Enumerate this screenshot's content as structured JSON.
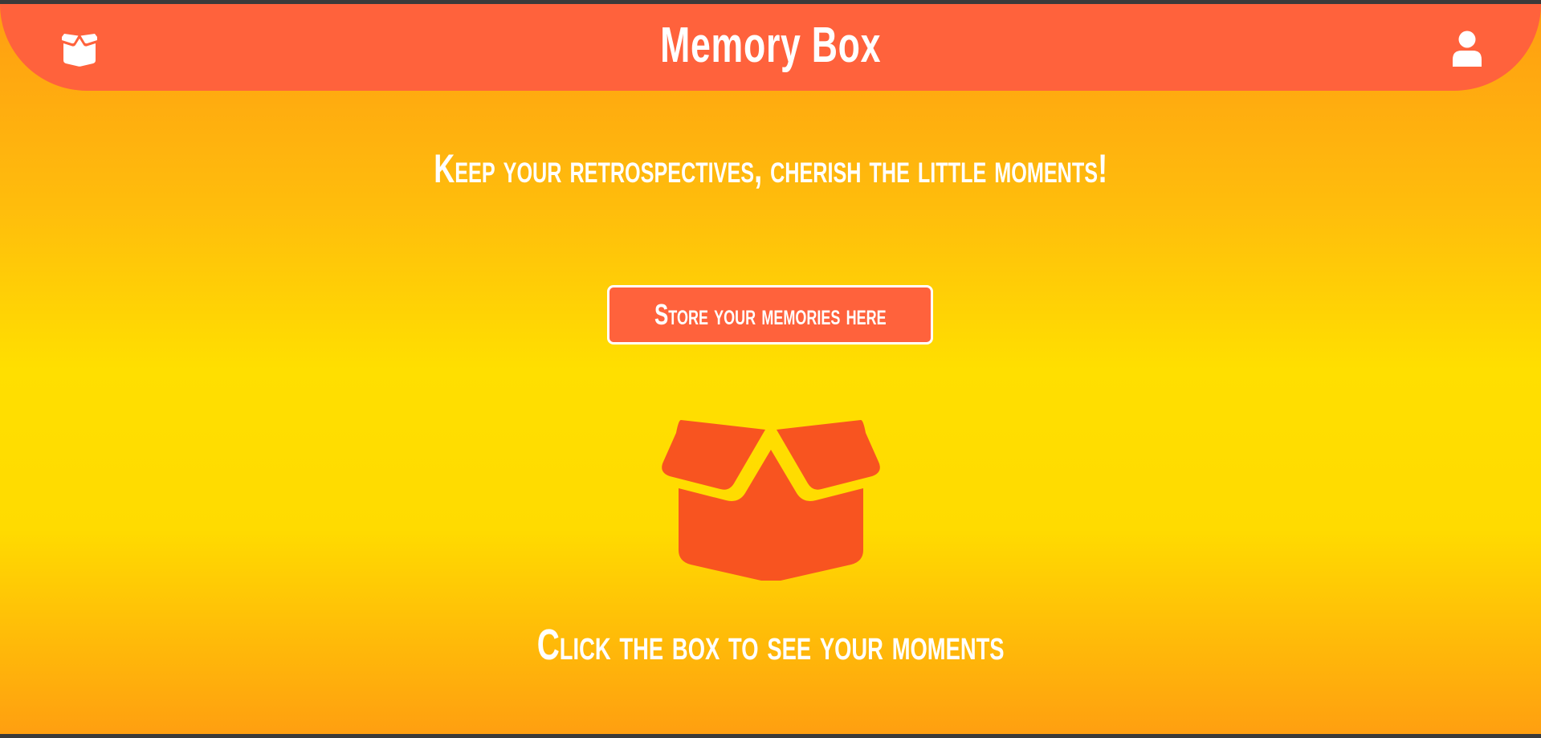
{
  "header": {
    "title": "Memory Box",
    "brand_icon": "open-box-icon",
    "account_icon": "user-icon",
    "background_color": "#ff623c"
  },
  "main": {
    "tagline": "Keep your retrospectives, cherish the little moments!",
    "store_button_label": "Store your memories here",
    "box_icon": "open-box-icon",
    "hint": "Click the box to see your moments"
  },
  "colors": {
    "accent": "#ff623c",
    "box": "#f85420",
    "gradient_yellow": "#ffdf00",
    "gradient_orange": "#ff9d12",
    "text": "#ffffff"
  }
}
